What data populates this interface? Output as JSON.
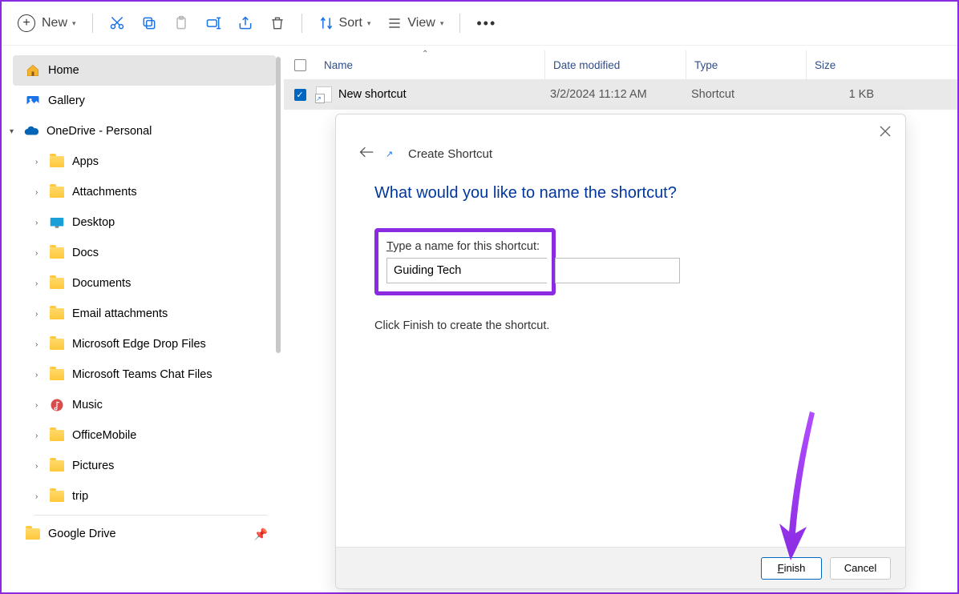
{
  "toolbar": {
    "new_label": "New",
    "sort_label": "Sort",
    "view_label": "View"
  },
  "sidebar": {
    "items": [
      {
        "label": "Home",
        "kind": "home"
      },
      {
        "label": "Gallery",
        "kind": "gallery"
      },
      {
        "label": "OneDrive - Personal",
        "kind": "onedrive",
        "expanded": true
      },
      {
        "label": "Apps",
        "kind": "folder"
      },
      {
        "label": "Attachments",
        "kind": "folder"
      },
      {
        "label": "Desktop",
        "kind": "desktop"
      },
      {
        "label": "Docs",
        "kind": "folder"
      },
      {
        "label": "Documents",
        "kind": "folder"
      },
      {
        "label": "Email attachments",
        "kind": "folder"
      },
      {
        "label": "Microsoft Edge Drop Files",
        "kind": "folder"
      },
      {
        "label": "Microsoft Teams Chat Files",
        "kind": "folder"
      },
      {
        "label": "Music",
        "kind": "music"
      },
      {
        "label": "OfficeMobile",
        "kind": "folder"
      },
      {
        "label": "Pictures",
        "kind": "folder"
      },
      {
        "label": "trip",
        "kind": "folder"
      },
      {
        "label": "Google Drive",
        "kind": "folder",
        "pinned": true
      }
    ]
  },
  "filelist": {
    "columns": {
      "name": "Name",
      "date": "Date modified",
      "type": "Type",
      "size": "Size"
    },
    "rows": [
      {
        "name": "New shortcut",
        "date": "3/2/2024 11:12 AM",
        "type": "Shortcut",
        "size": "1 KB",
        "checked": true
      }
    ]
  },
  "dialog": {
    "title": "Create Shortcut",
    "question": "What would you like to name the shortcut?",
    "field_label_pre": "T",
    "field_label_rest": "ype a name for this shortcut:",
    "value": "Guiding Tech",
    "hint": "Click Finish to create the shortcut.",
    "finish_pre": "F",
    "finish_rest": "inish",
    "cancel": "Cancel"
  }
}
